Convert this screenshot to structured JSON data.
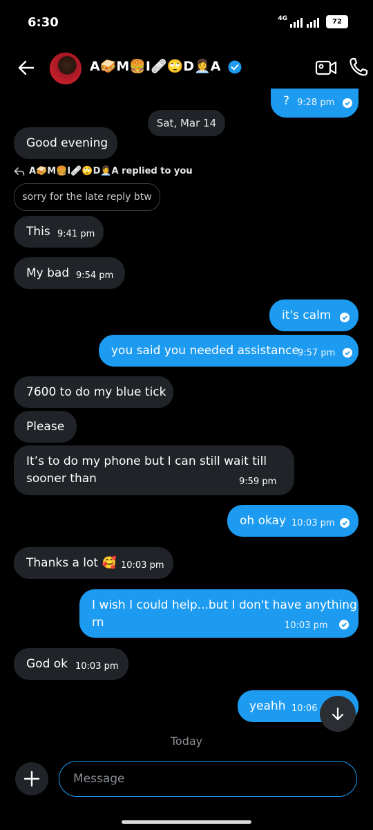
{
  "status_bar": {
    "time": "6:30",
    "network": "4G",
    "battery": "72"
  },
  "header": {
    "contact_name": "A🥪M🍔I🩹🙄D👩‍💼A"
  },
  "date_divider": "Sat, Mar 14",
  "reply": {
    "meta": "A🥪M🍔I🩹🙄D👩‍💼A replied to you",
    "quoted_text": "sorry for the late reply btw"
  },
  "messages": [
    {
      "dir": "out",
      "text": "?",
      "time": "9:28 pm"
    },
    {
      "dir": "in",
      "text": "Good evening",
      "time": ""
    },
    {
      "dir": "in",
      "text": "This",
      "time": "9:41 pm"
    },
    {
      "dir": "in",
      "text": "My bad",
      "time": "9:54 pm"
    },
    {
      "dir": "out",
      "text": "it's calm",
      "time": ""
    },
    {
      "dir": "out",
      "text": "you said you needed assistance",
      "time": "9:57 pm"
    },
    {
      "dir": "in",
      "text": "7600 to do my blue tick",
      "time": ""
    },
    {
      "dir": "in",
      "text": "Please",
      "time": ""
    },
    {
      "dir": "in",
      "text": "It’s to do my phone but I can still wait till",
      "text2": "sooner than",
      "time": "9:59 pm"
    },
    {
      "dir": "out",
      "text": "oh okay",
      "time": "10:03 pm"
    },
    {
      "dir": "in",
      "text": "Thanks a lot 🥰",
      "time": "10:03 pm"
    },
    {
      "dir": "out",
      "text": "I wish I could help...but I don't have anything",
      "text2": "rn",
      "time": "10:03 pm"
    },
    {
      "dir": "in",
      "text": "God ok",
      "time": "10:03 pm"
    },
    {
      "dir": "out",
      "text": "yeahh",
      "time": "10:06 pm"
    }
  ],
  "today_label": "Today",
  "composer": {
    "placeholder": "Message"
  },
  "colors": {
    "outgoing": "#1d9bf0",
    "incoming": "#202327",
    "background": "#000000",
    "verified": "#1d9bf0"
  }
}
